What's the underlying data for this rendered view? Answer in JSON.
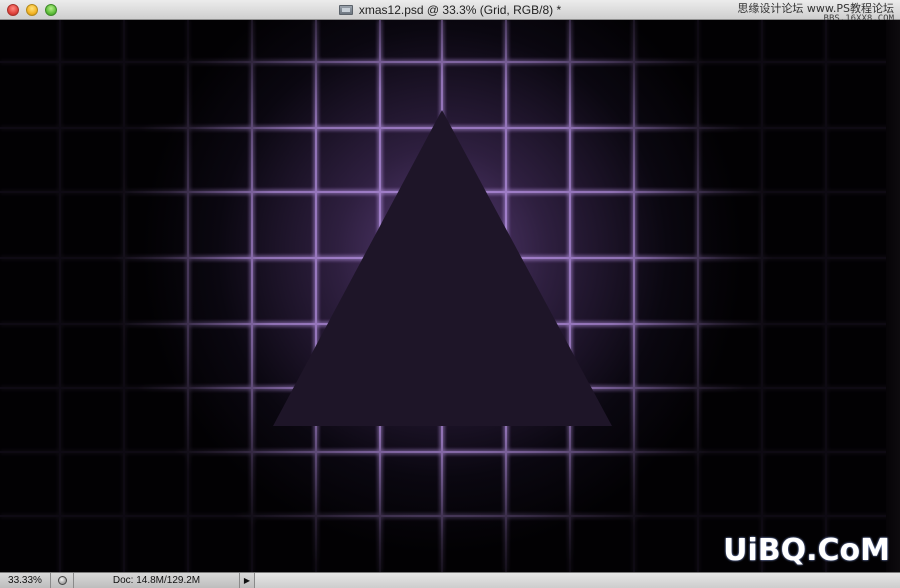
{
  "window": {
    "title": "xmas12.psd @ 33.3% (Grid, RGB/8) *",
    "document_icon": "image-document-icon"
  },
  "watermark_top": {
    "line1": "思缘设计论坛 www.PS教程论坛",
    "line2": "BBS.16XX8.COM"
  },
  "watermark_bottom": "UiBQ.CoM",
  "canvas": {
    "background_color": "#020103",
    "grid_color": "#b48fe0",
    "glow_color": "#5a3e78",
    "triangle_color": "#1e1528"
  },
  "status_bar": {
    "zoom": "33.33%",
    "doc_size": "Doc: 14.8M/129.2M",
    "share_icon": "share-icon",
    "arrow_icon": "play-arrow-icon"
  }
}
